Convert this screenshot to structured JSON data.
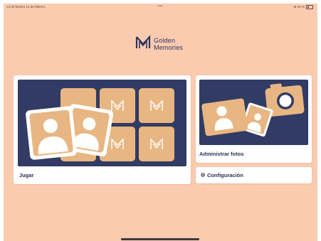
{
  "status_bar": {
    "time_date": "12:30  Martes 14 de febrero",
    "center_dots": "•••",
    "battery_text": "⋒ 18 %"
  },
  "brand": {
    "name_line1": "Golden",
    "name_line2": "Memories"
  },
  "cards": {
    "play_label": "Jugar",
    "photos_label": "Administrar fotos",
    "settings_label": "Configuración"
  },
  "icons": {
    "logo": "golden-memories-logo",
    "settings": "gear-icon",
    "play_art": "memory-cards-illustration",
    "photos_art": "photos-camera-illustration"
  },
  "colors": {
    "background": "#FACBAF",
    "navy": "#323B63",
    "tile": "#E8B682",
    "card": "#FFFFFF",
    "text": "#2A2F54"
  }
}
